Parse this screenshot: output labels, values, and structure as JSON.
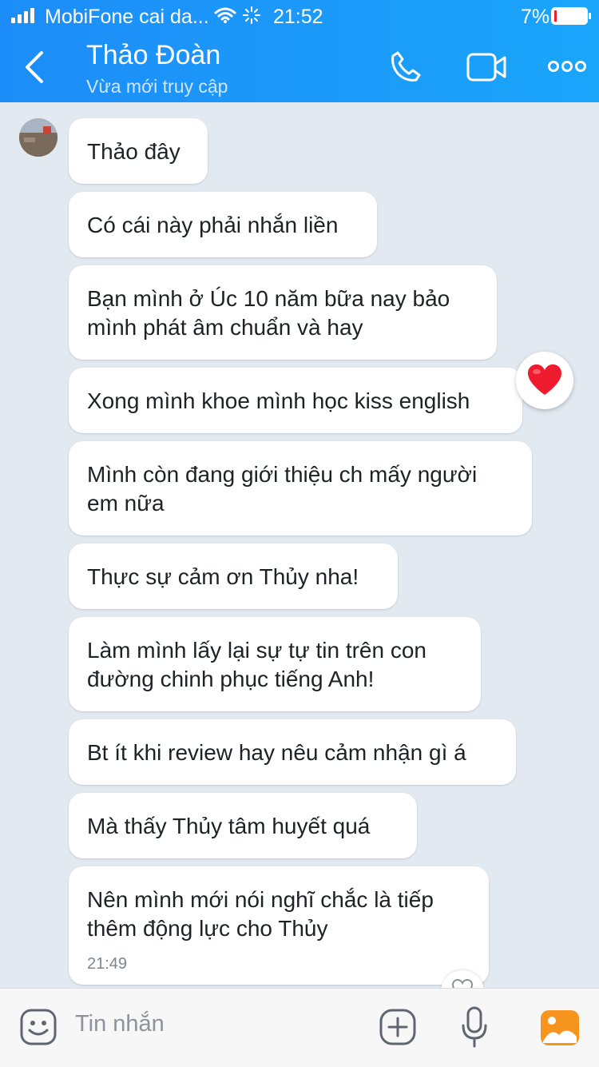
{
  "status_bar": {
    "carrier": "MobiFone cai da...",
    "time": "21:52",
    "battery": "7%"
  },
  "header": {
    "title": "Thảo Đoàn",
    "subtitle": "Vừa mới truy cập"
  },
  "messages": [
    {
      "text": "Thảo đây"
    },
    {
      "text": "Có cái này phải nhắn liền"
    },
    {
      "text": "Bạn mình ở Úc 10 năm bữa nay bảo mình phát âm chuẩn và hay"
    },
    {
      "text": "Xong mình khoe mình học kiss english",
      "reaction": "heart"
    },
    {
      "text": "Mình còn đang giới thiệu ch mấy người em nữa"
    },
    {
      "text": "Thực sự cảm ơn Thủy nha!"
    },
    {
      "text": "Làm mình lấy lại sự tự tin trên con đường chinh phục tiếng Anh!"
    },
    {
      "text": "Bt ít khi review hay nêu cảm nhận gì á"
    },
    {
      "text": "Mà thấy Thủy tâm huyết quá"
    },
    {
      "text": "Nên mình mới nói nghĩ chắc là tiếp thêm động lực cho Thủy",
      "time": "21:49"
    }
  ],
  "composer": {
    "placeholder": "Tin nhắn"
  },
  "colors": {
    "accent": "#1a96fa",
    "chat_bg": "#e2e9f1",
    "heart": "#ee1c2e"
  }
}
